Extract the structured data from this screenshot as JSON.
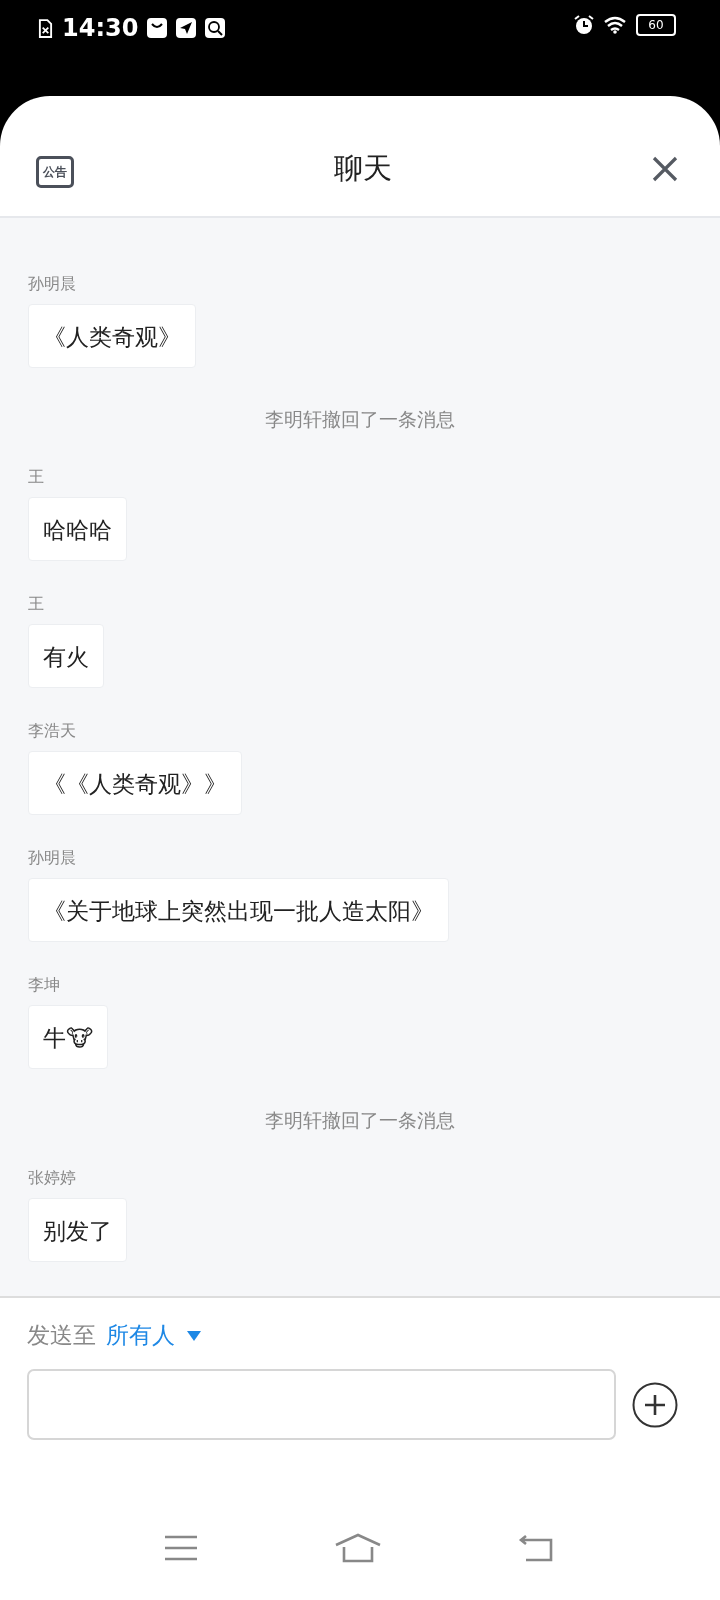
{
  "status_bar": {
    "time": "14:30",
    "battery": "60"
  },
  "header": {
    "announcement": "公告",
    "title": "聊天"
  },
  "messages": [
    {
      "kind": "message",
      "sender": "孙明晨",
      "text": "《人类奇观》"
    },
    {
      "kind": "notice",
      "text": "李明轩撤回了一条消息"
    },
    {
      "kind": "message",
      "sender": "王",
      "text": "哈哈哈"
    },
    {
      "kind": "message",
      "sender": "王",
      "text": "有火"
    },
    {
      "kind": "message",
      "sender": "李浩天",
      "text": "《《人类奇观》》"
    },
    {
      "kind": "message",
      "sender": "孙明晨",
      "text": "《关于地球上突然出现一批人造太阳》"
    },
    {
      "kind": "message",
      "sender": "李坤",
      "text": "牛🐮"
    },
    {
      "kind": "notice",
      "text": "李明轩撤回了一条消息"
    },
    {
      "kind": "message",
      "sender": "张婷婷",
      "text": "别发了"
    }
  ],
  "composer": {
    "send_to_label": "发送至",
    "recipient": "所有人"
  }
}
